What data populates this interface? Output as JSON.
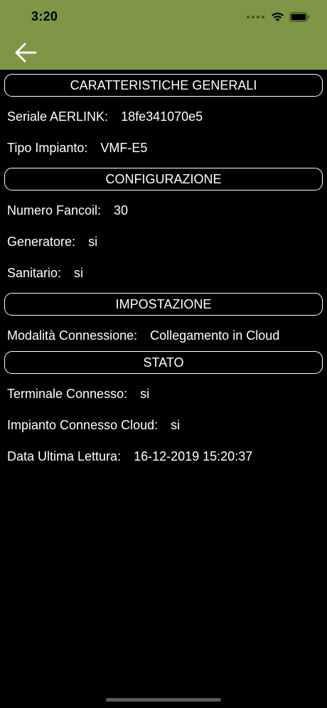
{
  "status_bar": {
    "time": "3:20"
  },
  "colors": {
    "header_bg": "#7f9647",
    "page_bg": "#000000",
    "text": "#ffffff"
  },
  "nav": {
    "back_icon": "arrow-left-icon"
  },
  "sections": {
    "general": {
      "title": "CARATTERISTICHE GENERALI",
      "serial_label": "Seriale AERLINK:",
      "serial_value": "18fe341070e5",
      "system_type_label": "Tipo Impianto:",
      "system_type_value": "VMF-E5"
    },
    "configuration": {
      "title": "CONFIGURAZIONE",
      "fancoil_label": "Numero Fancoil:",
      "fancoil_value": "30",
      "generator_label": "Generatore:",
      "generator_value": "si",
      "sanitary_label": "Sanitario:",
      "sanitary_value": "si"
    },
    "settings": {
      "title": "IMPOSTAZIONE",
      "connection_mode_label": "Modalità Connessione:",
      "connection_mode_value": "Collegamento in Cloud"
    },
    "status": {
      "title": "STATO",
      "terminal_label": "Terminale Connesso:",
      "terminal_value": "si",
      "cloud_label": "Impianto Connesso Cloud:",
      "cloud_value": "si",
      "last_read_label": "Data Ultima Lettura:",
      "last_read_value": "16-12-2019 15:20:37"
    }
  }
}
